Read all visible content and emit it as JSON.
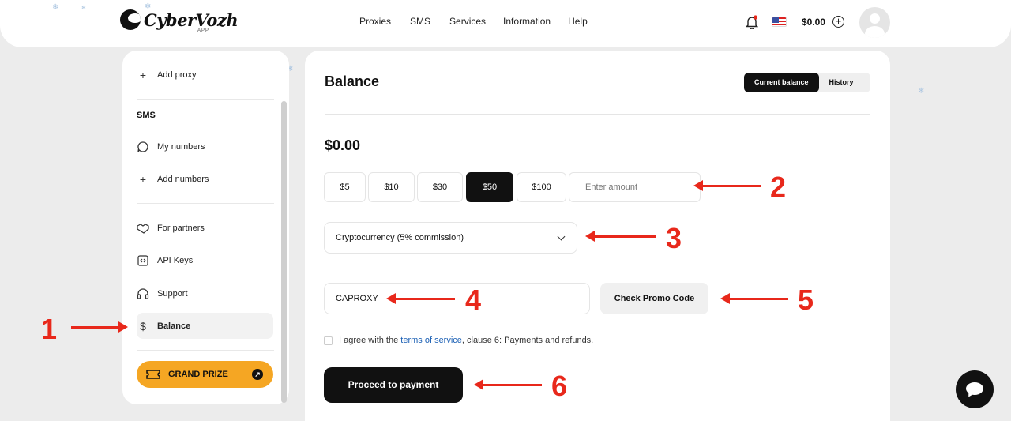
{
  "header": {
    "logo_text": "CyberVozh",
    "logo_sub": "APP",
    "nav": [
      "Proxies",
      "SMS",
      "Services",
      "Information",
      "Help"
    ],
    "balance": "$0.00",
    "icons": [
      "bell-icon",
      "us-flag-icon",
      "plus-circle-icon",
      "avatar"
    ]
  },
  "sidebar": {
    "add_proxy": "Add proxy",
    "sms_heading": "SMS",
    "my_numbers": "My numbers",
    "add_numbers": "Add numbers",
    "for_partners": "For partners",
    "api_keys": "API Keys",
    "support": "Support",
    "balance": "Balance",
    "grand_prize": "GRAND PRIZE"
  },
  "main": {
    "title": "Balance",
    "tabs": [
      "Current balance",
      "History"
    ],
    "active_tab": "Current balance",
    "amount": "$0.00",
    "chips": [
      "$5",
      "$10",
      "$30",
      "$50",
      "$100"
    ],
    "selected_chip": "$50",
    "amount_placeholder": "Enter amount",
    "payment_method": "Cryptocurrency (5% commission)",
    "promo_value": "CAPROXY",
    "check_promo": "Check Promo Code",
    "agree_prefix": "I agree with the",
    "agree_link": "terms of service",
    "agree_suffix": ", clause 6: Payments and refunds.",
    "proceed": "Proceed to payment"
  },
  "annotations": [
    "1",
    "2",
    "3",
    "4",
    "5",
    "6"
  ],
  "colors": {
    "accent": "#111111",
    "annotation": "#e8281b",
    "prize": "#f5a623",
    "link": "#1a5fb4"
  }
}
